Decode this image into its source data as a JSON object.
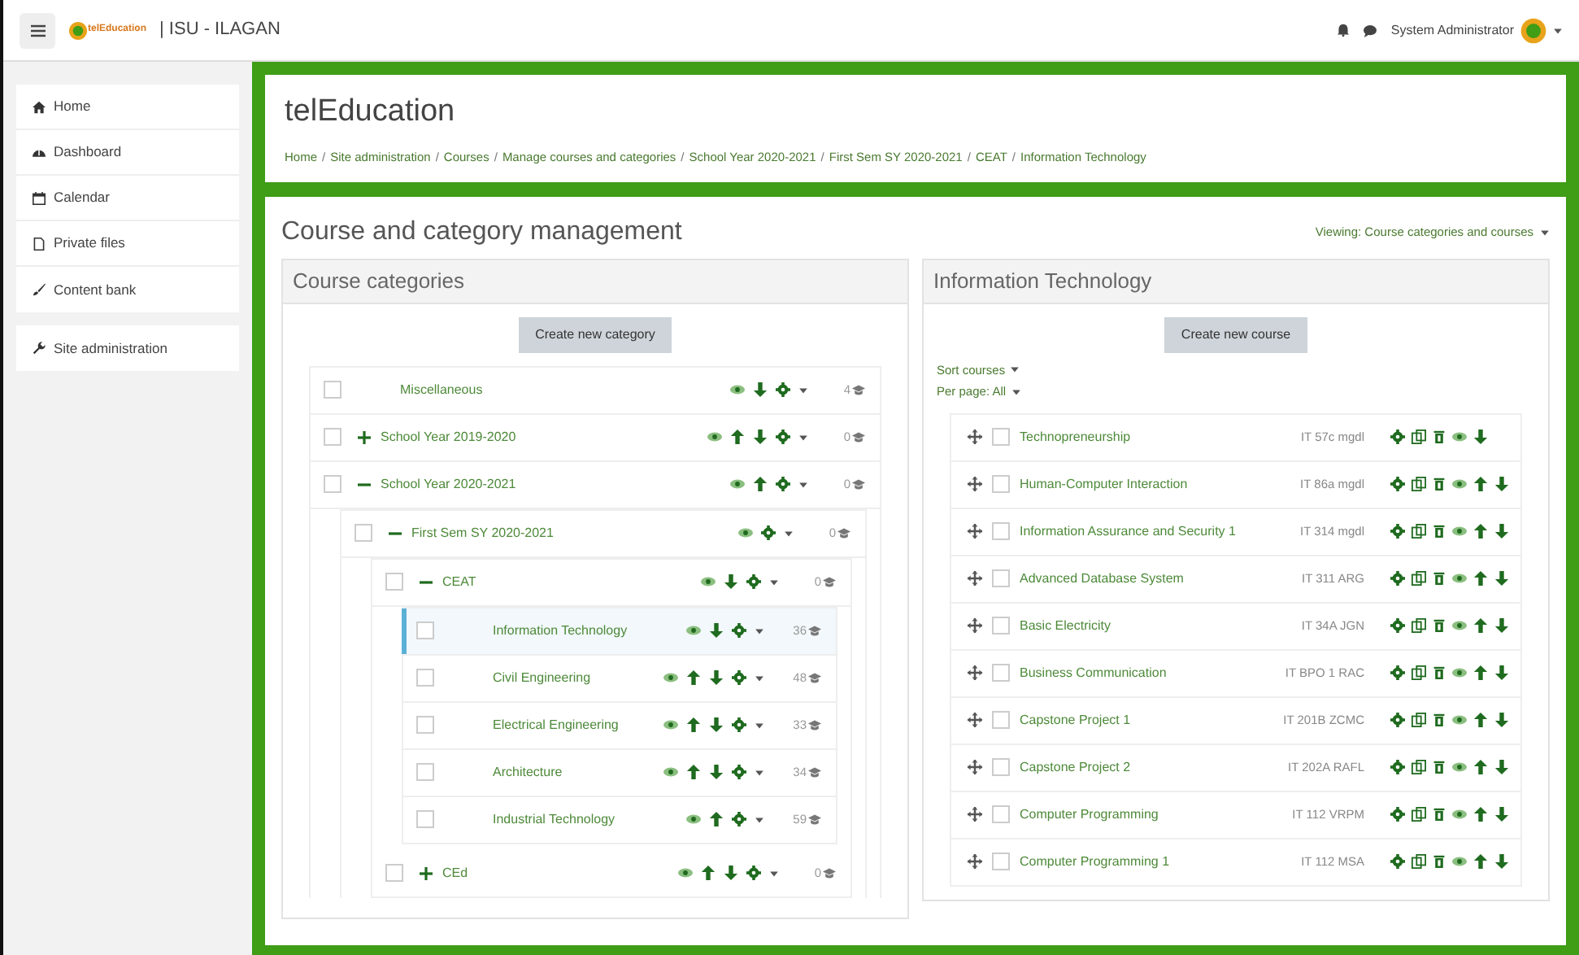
{
  "navbar": {
    "logo_text": "telEducation",
    "site": "| ISU - ILAGAN",
    "user": "System Administrator"
  },
  "sidebar": {
    "groups": [
      [
        {
          "kind": "home",
          "label": "Home"
        },
        {
          "kind": "dashboard",
          "label": "Dashboard"
        },
        {
          "kind": "calendar",
          "label": "Calendar"
        },
        {
          "kind": "file",
          "label": "Private files"
        },
        {
          "kind": "brush",
          "label": "Content bank"
        }
      ],
      [
        {
          "kind": "wrench",
          "label": "Site administration"
        }
      ]
    ]
  },
  "header": {
    "title": "telEducation",
    "breadcrumb_separator": "/",
    "breadcrumb": [
      "Home",
      "Site administration",
      "Courses",
      "Manage courses and categories",
      "School Year 2020-2021",
      "First Sem SY 2020-2021",
      "CEAT",
      "Information Technology"
    ]
  },
  "page_title": "Course and category management",
  "viewing": "Viewing: Course categories and courses",
  "categories_panel": {
    "title": "Course categories",
    "button": "Create new category",
    "items": [
      {
        "name": "Miscellaneous",
        "kind": "leaf",
        "checked": false,
        "move_up": false,
        "move_down": true,
        "count": "4",
        "selected": false
      },
      {
        "name": "School Year 2019-2020",
        "kind": "parent",
        "expanded": false,
        "checked": false,
        "move_up": true,
        "move_down": true,
        "count": "0",
        "selected": false
      },
      {
        "name": "School Year 2020-2021",
        "kind": "parent",
        "expanded": true,
        "checked": false,
        "move_up": true,
        "move_down": false,
        "count": "0",
        "selected": false,
        "children": [
          {
            "name": "First Sem SY 2020-2021",
            "kind": "parent",
            "expanded": true,
            "checked": false,
            "move_up": false,
            "move_down": false,
            "count": "0",
            "selected": false,
            "children": [
              {
                "name": "CEAT",
                "kind": "parent",
                "expanded": true,
                "checked": false,
                "move_up": false,
                "move_down": true,
                "count": "0",
                "selected": false,
                "children": [
                  {
                    "name": "Information Technology",
                    "kind": "leaf",
                    "checked": false,
                    "move_up": false,
                    "move_down": true,
                    "count": "36",
                    "selected": true
                  },
                  {
                    "name": "Civil Engineering",
                    "kind": "leaf",
                    "checked": false,
                    "move_up": true,
                    "move_down": true,
                    "count": "48",
                    "selected": false
                  },
                  {
                    "name": "Electrical Engineering",
                    "kind": "leaf",
                    "checked": false,
                    "move_up": true,
                    "move_down": true,
                    "count": "33",
                    "selected": false
                  },
                  {
                    "name": "Architecture",
                    "kind": "leaf",
                    "checked": false,
                    "move_up": true,
                    "move_down": true,
                    "count": "34",
                    "selected": false
                  },
                  {
                    "name": "Industrial Technology",
                    "kind": "leaf",
                    "checked": false,
                    "move_up": true,
                    "move_down": false,
                    "count": "59",
                    "selected": false
                  }
                ]
              },
              {
                "name": "CEd",
                "kind": "parent",
                "expanded": false,
                "checked": false,
                "move_up": true,
                "move_down": true,
                "count": "0",
                "selected": false
              }
            ]
          }
        ]
      }
    ]
  },
  "courses_panel": {
    "title": "Information Technology",
    "button": "Create new course",
    "sort": "Sort courses",
    "per_page": "Per page: All",
    "courses": [
      {
        "name": "Technopreneurship",
        "code": "IT 57c mgdl",
        "checked": false,
        "move_up": false,
        "move_down": true
      },
      {
        "name": "Human-Computer Interaction",
        "code": "IT 86a mgdl",
        "checked": false,
        "move_up": true,
        "move_down": true
      },
      {
        "name": "Information Assurance and Security 1",
        "code": "IT 314 mgdl",
        "checked": false,
        "move_up": true,
        "move_down": true
      },
      {
        "name": "Advanced Database System",
        "code": "IT 311 ARG",
        "checked": false,
        "move_up": true,
        "move_down": true
      },
      {
        "name": "Basic Electricity",
        "code": "IT 34A JGN",
        "checked": false,
        "move_up": true,
        "move_down": true
      },
      {
        "name": "Business Communication",
        "code": "IT BPO 1 RAC",
        "checked": false,
        "move_up": true,
        "move_down": true
      },
      {
        "name": "Capstone Project 1",
        "code": "IT 201B ZCMC",
        "checked": false,
        "move_up": true,
        "move_down": true
      },
      {
        "name": "Capstone Project 2",
        "code": "IT 202A RAFL",
        "checked": false,
        "move_up": true,
        "move_down": true
      },
      {
        "name": "Computer Programming",
        "code": "IT 112 VRPM",
        "checked": false,
        "move_up": true,
        "move_down": true
      },
      {
        "name": "Computer Programming 1",
        "code": "IT 112 MSA",
        "checked": false,
        "move_up": true,
        "move_down": true
      }
    ]
  }
}
